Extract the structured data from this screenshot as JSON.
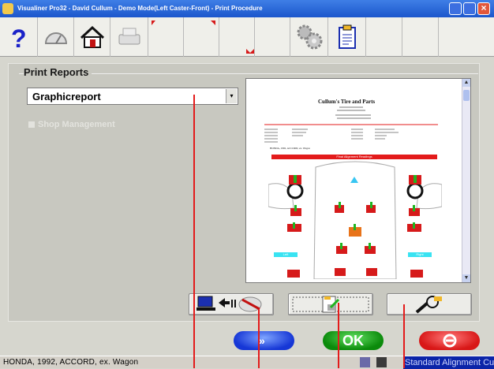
{
  "window": {
    "title": "Visualiner Pro32 - David Cullum - Demo Mode(Left Caster-Front) - Print Procedure"
  },
  "toolbar": {
    "items": [
      "help-icon",
      "gauge-icon",
      "home-icon",
      "printer-icon",
      "marker-1",
      "marker-2",
      "marker-3",
      "marker-4",
      "settings-icon",
      "clipboard-icon"
    ]
  },
  "print_reports": {
    "section_title": "Print Reports",
    "report_type": "Graphicreport",
    "shop_management_label": "Shop Management"
  },
  "preview": {
    "shop_name": "Cullum's Tire and Parts",
    "banner": "Final Alignment Readings",
    "vehicle_line": "HONDA, 1992, ACCORD, ex. Wagon",
    "left_label": "Left",
    "right_label": "Right"
  },
  "buttons": {
    "ok_label": "OK"
  },
  "status": {
    "vehicle": "HONDA, 1992, ACCORD, ex. Wagon",
    "mode": "Standard Alignment Cust"
  },
  "colors": {
    "accent_red": "#e31b1b",
    "ok_green": "#0b8a0b",
    "next_blue": "#1637d6",
    "status_blue": "#0b24a8"
  }
}
